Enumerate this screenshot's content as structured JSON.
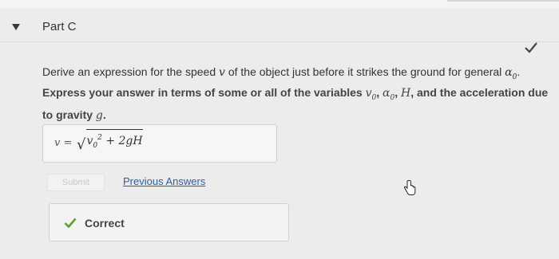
{
  "part": {
    "title": "Part C"
  },
  "question": {
    "text": "Derive an expression for the speed ",
    "var_v": "v",
    "text_2": " of the object just before it strikes the ground for general ",
    "var_alpha": "α",
    "var_alpha_sub": "0",
    "end": "."
  },
  "instruction": {
    "part1": "Express your answer in terms of some or all of the variables ",
    "v0": "v",
    "v0_sub": "0",
    "sep1": ", ",
    "alpha": "α",
    "alpha_sub": "0",
    "sep2": ", ",
    "H": "H",
    "part2": ", and the acceleration due to gravity ",
    "g": "g",
    "end": "."
  },
  "answer": {
    "label": "v =",
    "sqrt": "√",
    "v": "v",
    "sub": "0",
    "sup": "2",
    "rest": " + 2gH"
  },
  "actions": {
    "submit_label": "Submit",
    "previous_answers_label": "Previous Answers"
  },
  "feedback": {
    "text": "Correct"
  },
  "colors": {
    "check_green": "#5aa02c",
    "link_blue": "#2c5e9e"
  }
}
